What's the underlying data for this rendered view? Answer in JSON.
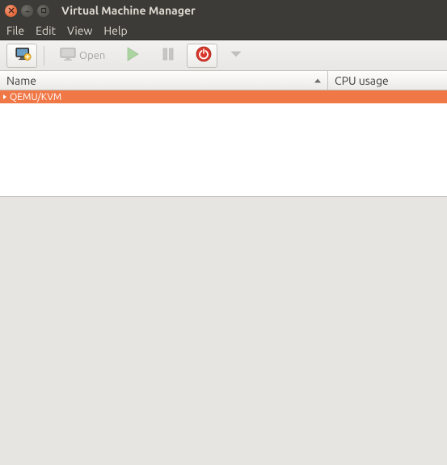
{
  "window": {
    "title": "Virtual Machine Manager"
  },
  "menu": {
    "file": "File",
    "edit": "Edit",
    "view": "View",
    "help": "Help"
  },
  "toolbar": {
    "open_label": "Open"
  },
  "table": {
    "headers": {
      "name": "Name",
      "cpu": "CPU usage"
    },
    "rows": [
      {
        "label": "QEMU/KVM"
      }
    ]
  }
}
